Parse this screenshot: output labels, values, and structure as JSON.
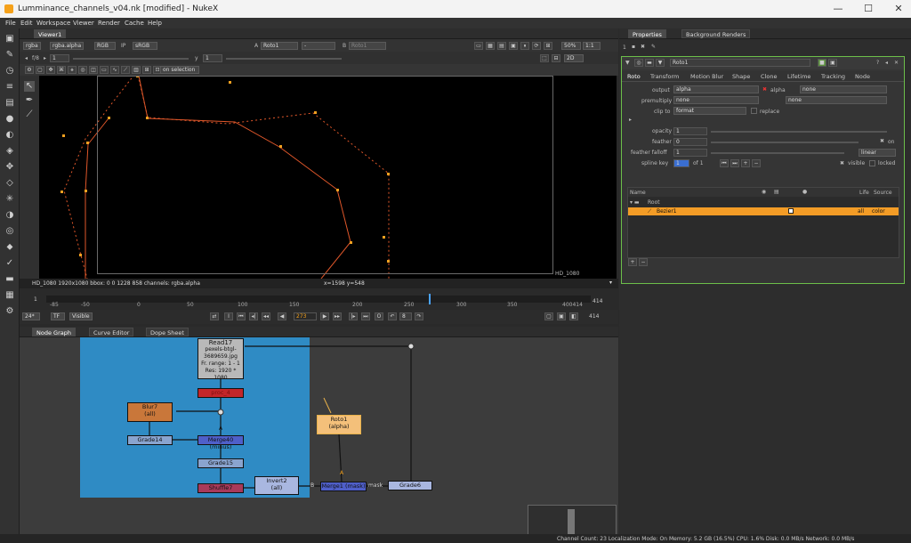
{
  "window": {
    "title": "Lumminance_channels_v04.nk [modified] - NukeX",
    "minimize": "—",
    "maximize": "☐",
    "close": "✕"
  },
  "menu": [
    "File",
    "Edit",
    "Workspace",
    "Viewer",
    "Render",
    "Cache",
    "Help"
  ],
  "viewer": {
    "tab": "Viewer1",
    "channels": "rgba",
    "channel_alpha": "rgba.alpha",
    "colorspace": "RGB",
    "ip_label": "IP",
    "lut": "sRGB",
    "input_a_label": "A",
    "input_a": "Roto1",
    "wipe": "-",
    "input_b_label": "B",
    "input_b": "Roto1",
    "zoom": "50%",
    "ratio": "1:1",
    "fstop": "f/8",
    "gain": "1",
    "gamma_label": "y",
    "gamma": "1",
    "view_mode": "2D",
    "on_selection": "on selection",
    "format_label": "HD_1080",
    "info_left": "HD_1080 1920x1080  bbox: 0 0 1228 858 channels: rgba.alpha",
    "coords": "x=1598 y=548"
  },
  "timeline": {
    "start": "1",
    "end": "414",
    "end2": "414",
    "frame": "273",
    "step": "8",
    "fps": "24*",
    "tf": "TF",
    "visible": "Visible",
    "ticks": [
      "-85",
      "-50",
      "0",
      "50",
      "100",
      "150",
      "200",
      "250",
      "300",
      "350",
      "400414"
    ]
  },
  "graph_tabs": [
    "Node Graph",
    "Curve Editor",
    "Dope Sheet"
  ],
  "nodes": {
    "read": {
      "name": "Read17",
      "file": "pexels-btgl-3689659.jpg",
      "range": "Fr. range: 1 - 1",
      "res": "Res: 1920 * 1080"
    },
    "red": "proc_4",
    "blur": {
      "name": "Blur7",
      "sub": "(all)"
    },
    "grade14": "Grade14",
    "merge": "Merge40 (minus)",
    "grade15": "Grade15",
    "shuffle": "Shuffle7",
    "invert": {
      "name": "Invert2",
      "sub": "(all)"
    },
    "merge_mask": "Merge1 (mask)",
    "grade6": "Grade6",
    "roto": {
      "name": "Roto1",
      "sub": "(alpha)"
    },
    "labels": {
      "a1": "A",
      "a2": "A",
      "b": "B",
      "mask": "mask"
    }
  },
  "properties": {
    "tabs": [
      "Properties",
      "Background Renders"
    ],
    "count": "1",
    "node_name": "Roto1",
    "subtabs": [
      "Roto",
      "Transform",
      "Motion Blur",
      "Shape",
      "Clone",
      "Lifetime",
      "Tracking",
      "Node"
    ],
    "output_label": "output",
    "output": "alpha",
    "alpha_check": "alpha",
    "output2": "none",
    "premult_label": "premultiply",
    "premult": "none",
    "premult2": "none",
    "clip_label": "clip to",
    "clip": "format",
    "replace": "replace",
    "opacity_label": "opacity",
    "opacity": "1",
    "feather_label": "feather",
    "feather": "0",
    "feather_on": "on",
    "falloff_label": "feather falloff",
    "falloff": "1",
    "falloff_type": "linear",
    "splinekey_label": "spline key",
    "splinekey": "1",
    "of": "of 1",
    "visible": "visible",
    "locked": "locked",
    "ticks": [
      "0",
      "0.1",
      "0.2",
      "0.3",
      "0.4",
      "0.5",
      "0.6",
      "0.7",
      "0.8",
      "0.9",
      "1"
    ],
    "list_headers": [
      "Name",
      "Life",
      "Source"
    ],
    "rows": [
      {
        "name": "Root"
      },
      {
        "name": "Bezier1",
        "life": "all",
        "source": "color"
      }
    ]
  },
  "status": "Channel Count: 23  Localization Mode: On  Memory: 5.2 GB (16.5%)  CPU: 1.6%  Disk: 0.0 MB/s  Network: 0.0 MB/s",
  "colors": {
    "accent": "#f5a11a",
    "selection": "#f39c26",
    "panel_border": "#6cbf4a",
    "backdrop": "#2f8bc4"
  },
  "icons": [
    "nuke-icon",
    "select-icon",
    "brush-icon",
    "blur-icon",
    "play-icon",
    "gear-icon"
  ]
}
